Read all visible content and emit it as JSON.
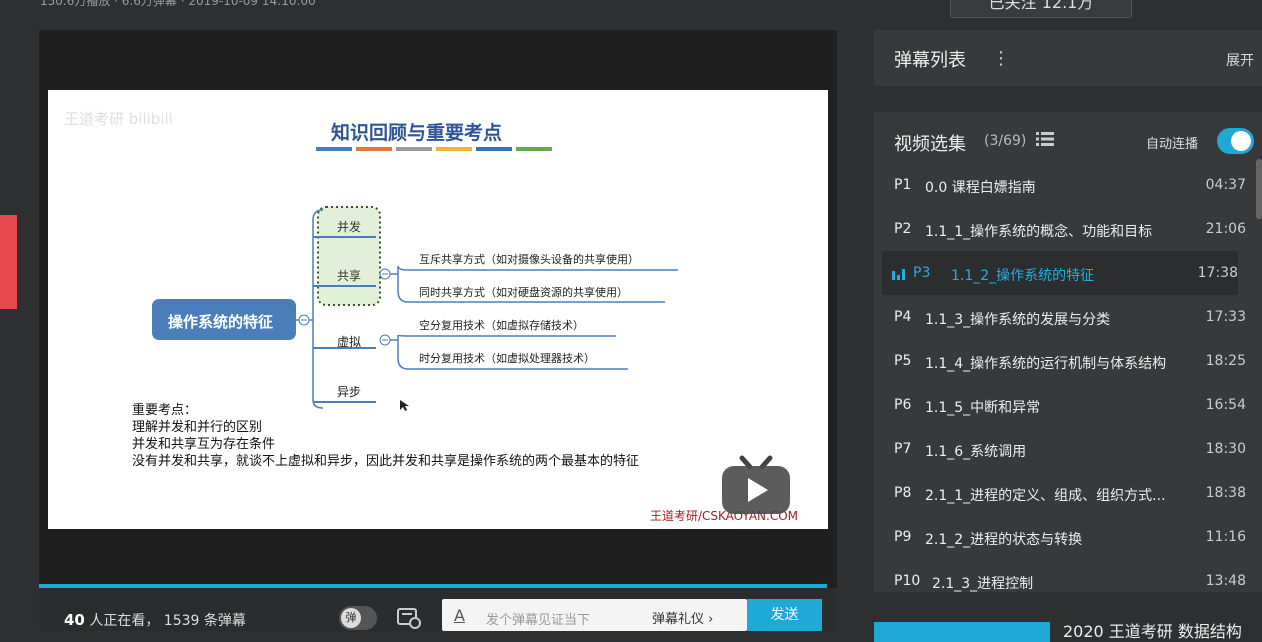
{
  "top_meta": "150.6万播放 · 6.6万弹幕 · 2019-10-09 14:10:00",
  "follow_button": "已关注 12.1万",
  "player": {
    "viewers_count": "40",
    "viewers_label": "人正在看，",
    "danmaku_count": "1539",
    "danmaku_label": "条弹幕",
    "danmaku_toggle": "弹",
    "input_placeholder": "发个弹幕见证当下",
    "etiquette_label": "弹幕礼仪",
    "send_label": "发送",
    "progress": 1.0
  },
  "slide": {
    "watermark": "王道考研 bilibili",
    "title": "知识回顾与重要考点",
    "root": "操作系统的特征",
    "nodes": {
      "concurrency": "并发",
      "sharing": "共享",
      "virtual": "虚拟",
      "async": "异步"
    },
    "sharing_children": [
      "互斥共享方式（如对摄像头设备的共享使用）",
      "同时共享方式（如对硬盘资源的共享使用）"
    ],
    "virtual_children": [
      "空分复用技术（如虚拟存储技术）",
      "时分复用技术（如虚拟处理器技术）"
    ],
    "notes": [
      "重要考点：",
      "理解并发和并行的区别",
      "并发和共享互为存在条件",
      "没有并发和共享，就谈不上虚拟和异步，因此并发和共享是操作系统的两个最基本的特征"
    ],
    "credit": "王道考研/CSKAOYAN.COM",
    "underline_colors": [
      "#4a7ebb",
      "#e07a3b",
      "#9a9a9a",
      "#f0b43a",
      "#3e6fb5",
      "#6aa84f"
    ]
  },
  "danmaku_panel": {
    "title": "弹幕列表",
    "expand": "展开"
  },
  "playlist": {
    "title": "视频选集",
    "count": "(3/69)",
    "autoplay_label": "自动连播",
    "autoplay_on": true,
    "items": [
      {
        "num": "P1",
        "title": "0.0 课程白嫖指南",
        "duration": "04:37"
      },
      {
        "num": "P2",
        "title": "1.1_1_操作系统的概念、功能和目标",
        "duration": "21:06"
      },
      {
        "num": "P3",
        "title": "1.1_2_操作系统的特征",
        "duration": "17:38"
      },
      {
        "num": "P4",
        "title": "1.1_3_操作系统的发展与分类",
        "duration": "17:33"
      },
      {
        "num": "P5",
        "title": "1.1_4_操作系统的运行机制与体系结构",
        "duration": "18:25"
      },
      {
        "num": "P6",
        "title": "1.1_5_中断和异常",
        "duration": "16:54"
      },
      {
        "num": "P7",
        "title": "1.1_6_系统调用",
        "duration": "18:30"
      },
      {
        "num": "P8",
        "title": "2.1_1_进程的定义、组成、组织方式...",
        "duration": "18:38"
      },
      {
        "num": "P9",
        "title": "2.1_2_进程的状态与转换",
        "duration": "11:16"
      },
      {
        "num": "P10",
        "title": "2.1_3_进程控制",
        "duration": "13:48"
      }
    ]
  },
  "recommend_title": "2020 王道考研 数据结构"
}
